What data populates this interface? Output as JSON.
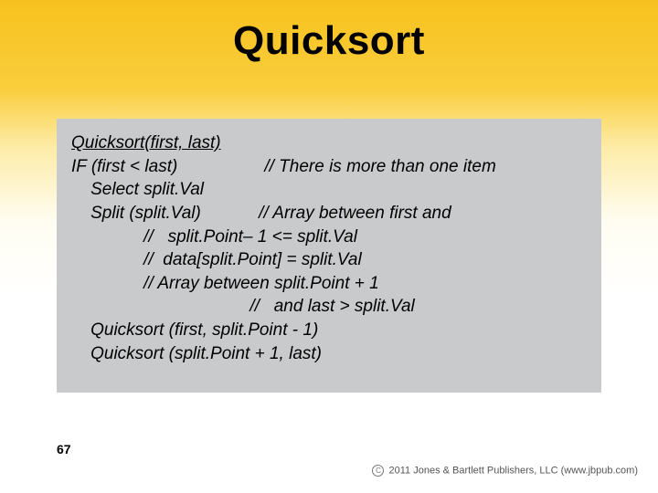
{
  "title": "Quicksort",
  "code": {
    "heading": "Quicksort(first, last)",
    "lines": [
      "IF (first < last)                  // There is more than one item",
      "    Select split.Val",
      "    Split (split.Val)            // Array between first and",
      "               //   split.Point– 1 <= split.Val",
      "               //  data[split.Point] = split.Val",
      "               // Array between split.Point + 1",
      "                                     //   and last > split.Val",
      "    Quicksort (first, split.Point - 1)",
      "    Quicksort (split.Point + 1, last)"
    ]
  },
  "page_number": "67",
  "footer": {
    "copyright_c": "C",
    "text": "2011 Jones & Bartlett Publishers, LLC (www.jbpub.com)"
  }
}
